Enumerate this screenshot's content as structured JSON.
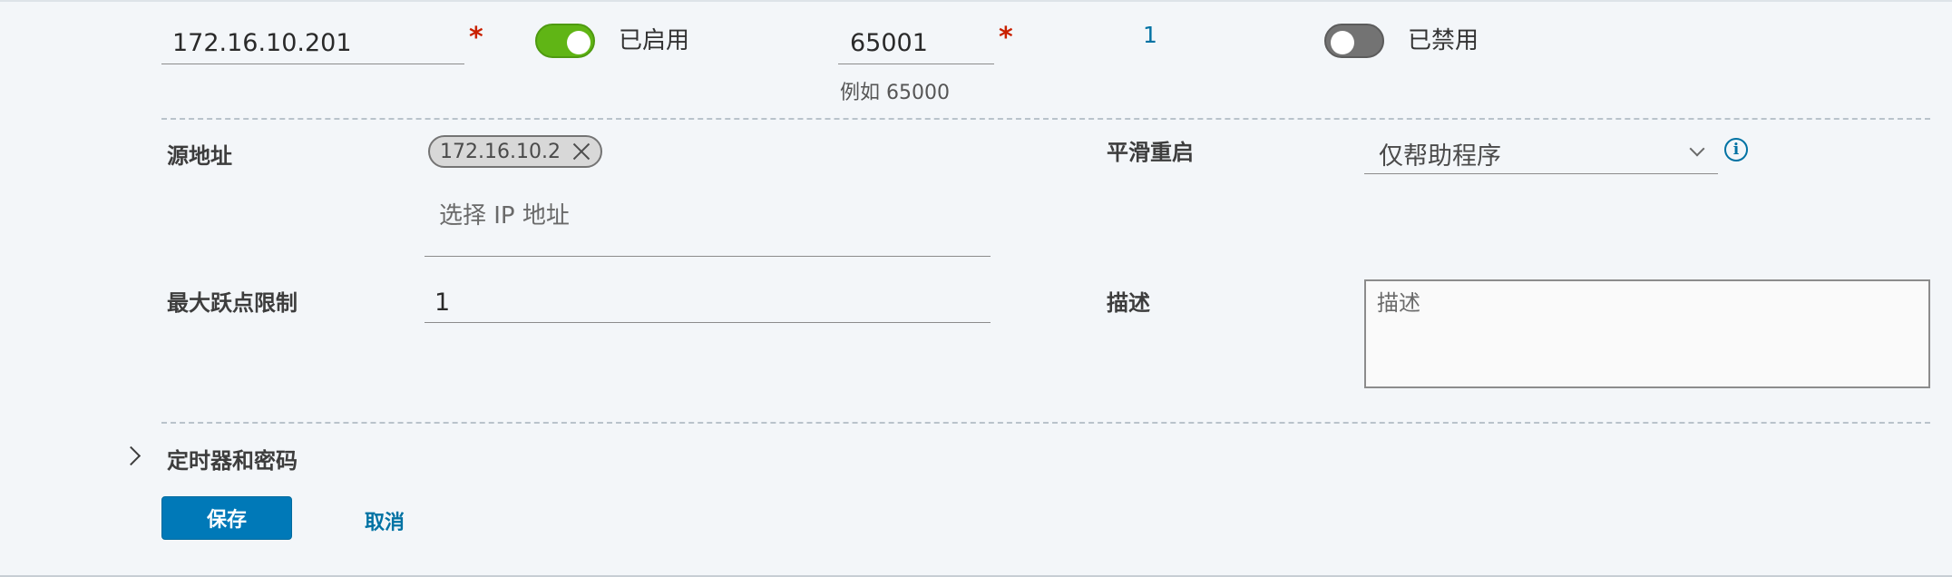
{
  "bgp_row": {
    "neighbor_ip": "172.16.10.201",
    "required_mark": "*",
    "bfd_toggle_label": "已启用",
    "remote_as": "65001",
    "remote_as_hint": "例如 65000",
    "route_filter_count": "1",
    "allowas_toggle_label": "已禁用"
  },
  "form": {
    "source_address_label": "源地址",
    "source_chip": "172.16.10.2",
    "source_placeholder": "选择 IP 地址",
    "graceful_restart_label": "平滑重启",
    "graceful_restart_value": "仅帮助程序",
    "max_hop_label": "最大跃点限制",
    "max_hop_value": "1",
    "description_label": "描述",
    "description_placeholder": "描述"
  },
  "timers_section": {
    "label": "定时器和密码"
  },
  "actions": {
    "save_label": "保存",
    "cancel_label": "取消"
  },
  "colors": {
    "accent": "#0079b8",
    "link": "#0072a3",
    "toggle_on": "#60b515",
    "toggle_off": "#737373",
    "required": "#c92100",
    "background": "#f3f6f9"
  },
  "icons": {
    "chip_remove": "close-icon",
    "select_arrow": "chevron-down-icon",
    "info": "info-icon",
    "expand": "chevron-right-icon"
  }
}
